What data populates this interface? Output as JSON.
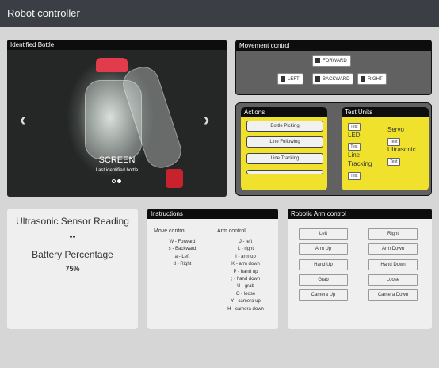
{
  "app": {
    "title": "Robot controller"
  },
  "carousel": {
    "header": "Identified Bottle",
    "caption_title": "SCREEN",
    "caption_sub": "Last identified bottle",
    "prev_glyph": "‹",
    "next_glyph": "›"
  },
  "movement": {
    "header": "Movement control",
    "forward": "FORWARD",
    "left": "LEFT",
    "backward": "BACKWARD",
    "right": "RIGHT"
  },
  "actions": {
    "header": "Actions",
    "buttons": [
      "Bottle Picking",
      "Line Following",
      "Line Tracking",
      ""
    ]
  },
  "test_units": {
    "header": "Test Units",
    "led": "LED",
    "line_tracking_1": "Line",
    "line_tracking_2": "Tracking",
    "servo": "Servo",
    "ultrasonic": "Ultrasonic",
    "test": "Test"
  },
  "sensor": {
    "title": "Ultrasonic Sensor Reading",
    "reading": "--",
    "battery_title": "Battery Percentage",
    "battery_value": "75%"
  },
  "instructions": {
    "header": "Instructions",
    "move_title": "Move control",
    "move_items": [
      "W - Forward",
      "s - Backward",
      "a - Left",
      "d - Right"
    ],
    "arm_title": "Arm control",
    "arm_items": [
      "J - left",
      "L - right",
      "I - arm up",
      "K - arm down",
      "P - hand up",
      "; - hand down",
      "U - grab",
      "O - loose",
      "Y - camera up",
      "H - camera down"
    ]
  },
  "arm_control": {
    "header": "Robotic Arm control",
    "left": [
      "Left",
      "Arm Up",
      "Hand Up",
      "Grab",
      "Camera Up"
    ],
    "right": [
      "Right",
      "Arm Down",
      "Hand Down",
      "Loose",
      "Camera Down"
    ]
  }
}
